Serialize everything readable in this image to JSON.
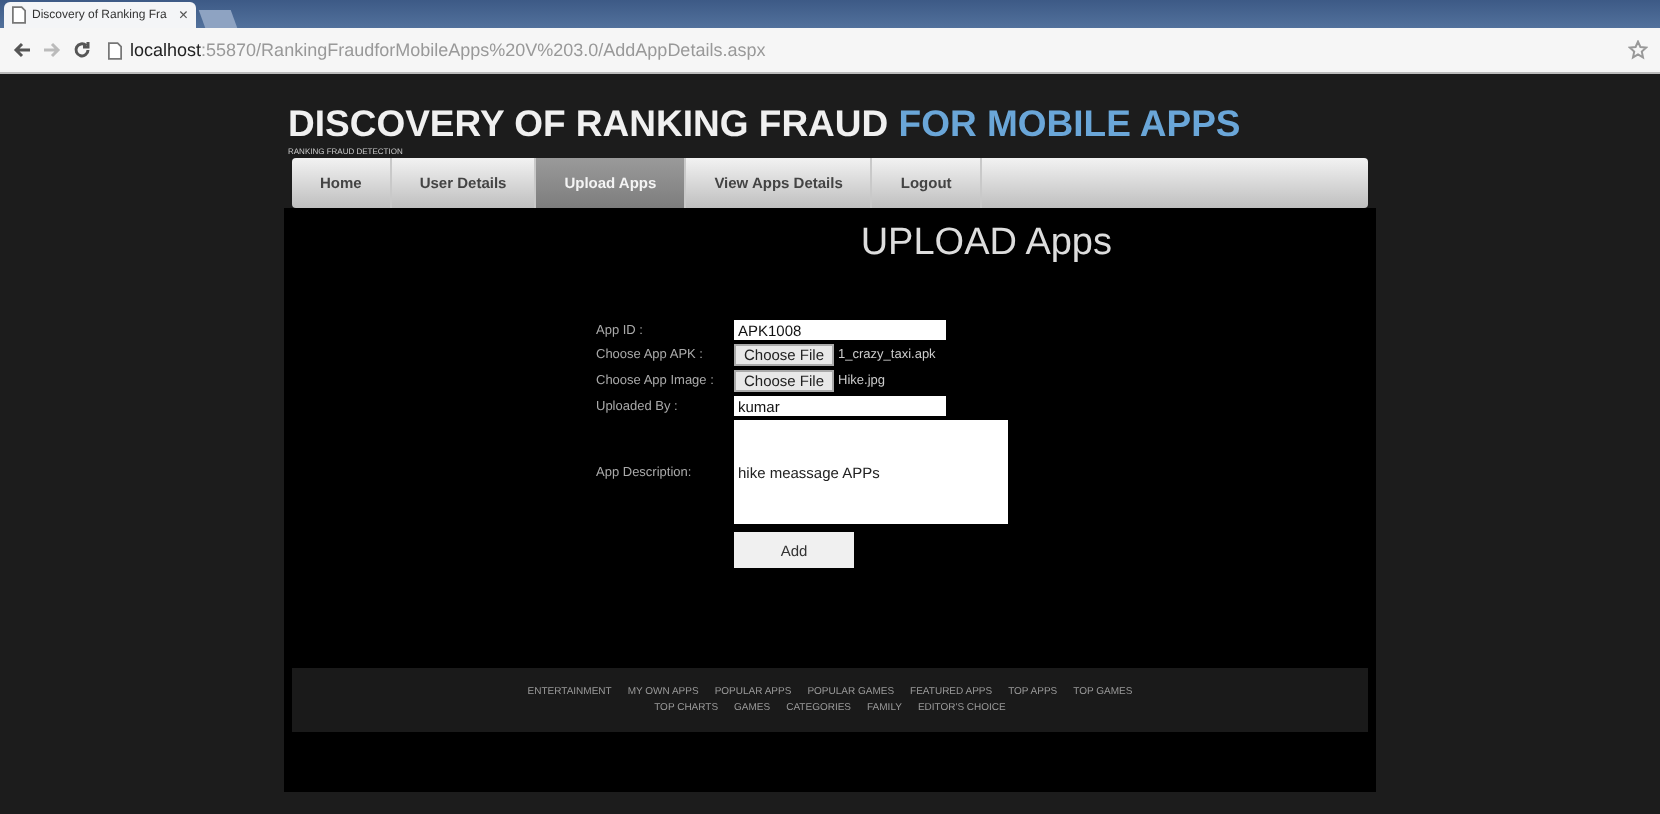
{
  "browser": {
    "tab_title": "Discovery of Ranking Fra",
    "tab_close": "×",
    "address": {
      "host": "localhost",
      "path": ":55870/RankingFraudforMobileApps%20V%203.0/AddAppDetails.aspx"
    }
  },
  "header": {
    "title": "DISCOVERY OF RANKING FRAUD",
    "title_highlight": "FOR MOBILE APPS",
    "subtitle": "RANKING FRAUD DETECTION"
  },
  "nav": [
    {
      "label": "Home",
      "selected": false
    },
    {
      "label": "User Details",
      "selected": false
    },
    {
      "label": "Upload Apps",
      "selected": true
    },
    {
      "label": "View Apps Details",
      "selected": false
    },
    {
      "label": "Logout",
      "selected": false
    }
  ],
  "heading": "UPLOAD Apps",
  "form": [
    {
      "kind": "text",
      "label": "App ID :",
      "value": "APK1008"
    },
    {
      "kind": "file",
      "label": "Choose App APK :",
      "button": "Choose File",
      "file": "1_crazy_taxi.apk"
    },
    {
      "kind": "file",
      "label": "Choose App Image :",
      "button": "Choose File",
      "file": "Hike.jpg"
    },
    {
      "kind": "text",
      "label": "Uploaded By :",
      "value": "kumar"
    },
    {
      "kind": "textarea",
      "label": "App Description:",
      "value": "hike meassage APPs"
    }
  ],
  "submit": "Add",
  "footer_links": [
    [
      "ENTERTAINMENT",
      "MY OWN APPS",
      "POPULAR APPS",
      "POPULAR GAMES",
      "FEATURED APPS",
      "TOP APPS",
      "TOP GAMES"
    ],
    [
      "TOP CHARTS",
      "GAMES",
      "CATEGORIES",
      "FAMILY",
      "EDITOR'S CHOICE"
    ]
  ]
}
